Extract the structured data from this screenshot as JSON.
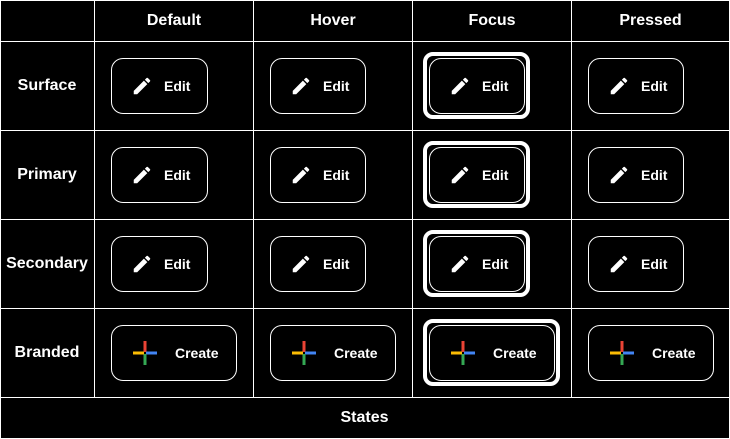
{
  "columns": [
    "Default",
    "Hover",
    "Focus",
    "Pressed"
  ],
  "rows": [
    "Surface",
    "Primary",
    "Secondary",
    "Branded"
  ],
  "footer": "States",
  "edit_label": "Edit",
  "create_label": "Create",
  "icons": {
    "edit": "pencil-icon",
    "create": "google-plus-icon"
  },
  "colors": {
    "background": "#000000",
    "foreground": "#ffffff",
    "plus_red": "#EA4335",
    "plus_blue": "#4285F4",
    "plus_green": "#34A853",
    "plus_yellow": "#FBBC04"
  }
}
